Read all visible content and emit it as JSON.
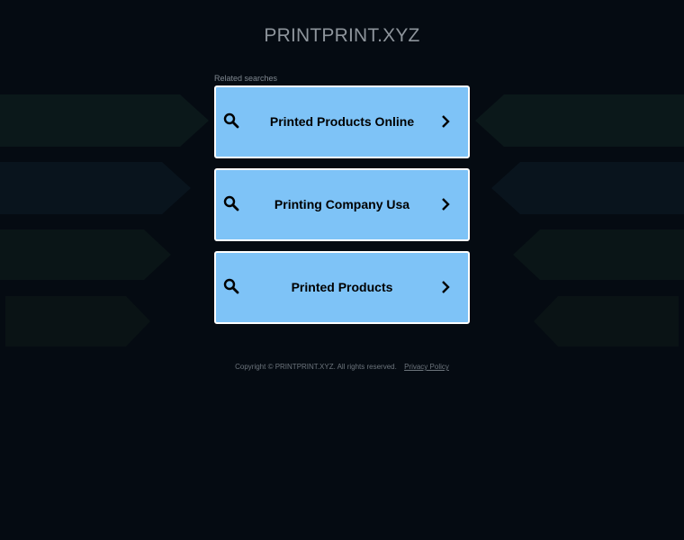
{
  "site": {
    "title": "PRINTPRINT.XYZ"
  },
  "related": {
    "label": "Related searches",
    "items": [
      {
        "label": "Printed Products Online",
        "icon": "search-icon",
        "arrow": "chevron-right-icon"
      },
      {
        "label": "Printing Company Usa",
        "icon": "search-icon",
        "arrow": "chevron-right-icon"
      },
      {
        "label": "Printed Products",
        "icon": "search-icon",
        "arrow": "chevron-right-icon"
      }
    ]
  },
  "footer": {
    "copyright": "Copyright © PRINTPRINT.XYZ.  All rights reserved.",
    "privacy_link": "Privacy Policy"
  },
  "colors": {
    "background": "#050b12",
    "card": "#7ec3f7",
    "card_border": "#ffffff",
    "text_muted": "#8d949b"
  }
}
